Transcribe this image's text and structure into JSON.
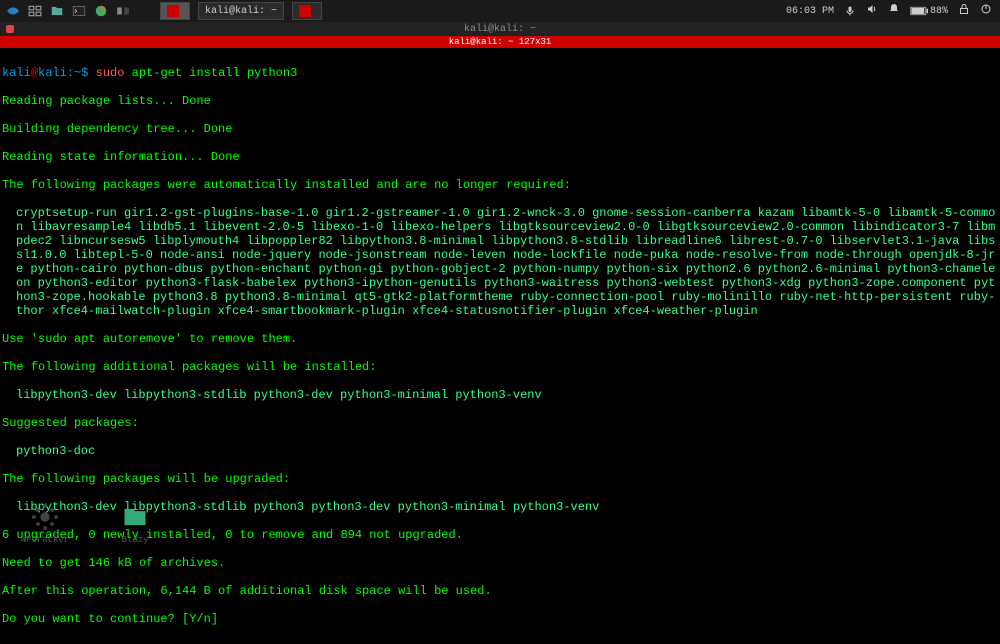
{
  "taskbar": {
    "time": "06:03 PM",
    "battery": "88%",
    "task_items": [
      {
        "label": "",
        "color": "#cc0000"
      },
      {
        "label": "kali@kali: ~",
        "color": ""
      },
      {
        "label": "",
        "color": "#cc0000"
      }
    ]
  },
  "window": {
    "title": "kali@kali: ~",
    "tab_title": "kali@kali: ~ 127x31"
  },
  "prompt": {
    "user": "kali",
    "at": "@",
    "host": "kali",
    "path_sep": ":~",
    "symbol": "$ ",
    "sudo": "sudo",
    "command": " apt-get install python3"
  },
  "output": {
    "l1": "Reading package lists... Done",
    "l2": "Building dependency tree... Done",
    "l3": "Reading state information... Done",
    "l4": "The following packages were automatically installed and are no longer required:",
    "pkg1": "cryptsetup-run gir1.2-gst-plugins-base-1.0 gir1.2-gstreamer-1.0 gir1.2-wnck-3.0 gnome-session-canberra kazam libamtk-5-0 libamtk-5-common libavresample4 libdb5.1 libevent-2.0-5 libexo-1-0 libexo-helpers libgtksourceview2.0-0 libgtksourceview2.0-common libindicator3-7 libmpdec2 libncursesw5 libplymouth4 libpoppler82 libpython3.8-minimal libpython3.8-stdlib libreadline6 librest-0.7-0 libservlet3.1-java libssl1.0.0 libtepl-5-0 node-ansi node-jquery node-jsonstream node-leven node-lockfile node-puka node-resolve-from node-through openjdk-8-jre python-cairo python-dbus python-enchant python-gi python-gobject-2 python-numpy python-six python2.6 python2.6-minimal python3-chameleon python3-editor python3-flask-babelex python3-ipython-genutils python3-waitress python3-webtest python3-xdg python3-zope.component python3-zope.hookable python3.8 python3.8-minimal qt5-gtk2-platformtheme ruby-connection-pool ruby-molinillo ruby-net-http-persistent ruby-thor xfce4-mailwatch-plugin xfce4-smartbookmark-plugin xfce4-statusnotifier-plugin xfce4-weather-plugin",
    "l5": "Use 'sudo apt autoremove' to remove them.",
    "l6": "The following additional packages will be installed:",
    "pkg2": "libpython3-dev libpython3-stdlib python3-dev python3-minimal python3-venv",
    "l7": "Suggested packages:",
    "pkg3": "python3-doc",
    "l8": "The following packages will be upgraded:",
    "pkg4": "libpython3-dev libpython3-stdlib python3 python3-dev python3-minimal python3-venv",
    "l9": "6 upgraded, 0 newly installed, 0 to remove and 894 not upgraded.",
    "l10": "Need to get 146 kB of archives.",
    "l11": "After this operation, 6,144 B of additional disk space will be used.",
    "l12": "Do you want to continue? [Y/n]"
  },
  "desktop": {
    "icon1_label": "WPCracker",
    "icon2_label": "Blazy"
  }
}
